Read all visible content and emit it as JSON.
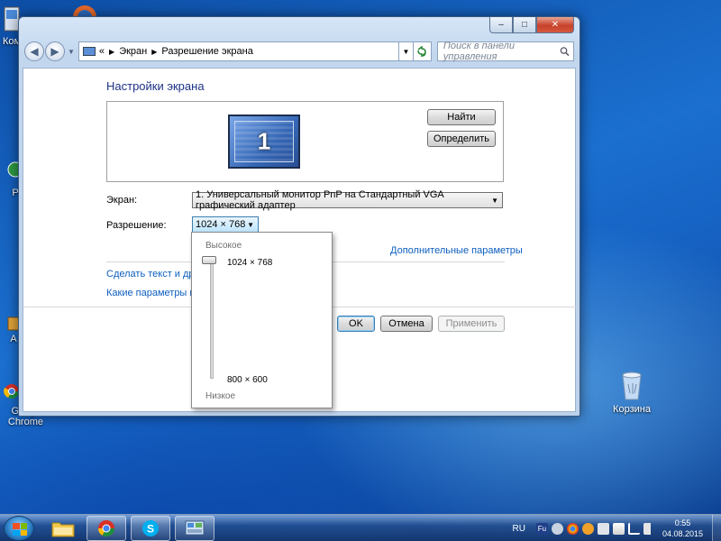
{
  "desktop": {
    "icons": [
      {
        "label": "Ком"
      },
      {
        "label": ""
      },
      {
        "label": "P"
      },
      {
        "label": "A"
      },
      {
        "label": "Google Chrome"
      }
    ],
    "recycle_bin_label": "Корзина"
  },
  "window": {
    "caption_buttons": {
      "minimize": "–",
      "maximize": "□",
      "close": "✕"
    },
    "nav": {
      "back": "◀",
      "forward": "▶"
    },
    "address": {
      "prefix": "«",
      "crumbs": [
        "Экран",
        "Разрешение экрана"
      ]
    },
    "search": {
      "placeholder": "Поиск в панели управления"
    },
    "heading": "Настройки экрана",
    "monitor_number": "1",
    "buttons": {
      "find": "Найти",
      "identify": "Определить",
      "ok": "OK",
      "cancel": "Отмена",
      "apply": "Применить"
    },
    "display_label": "Экран:",
    "display_value": "1. Универсальный монитор PnP на Стандартный VGA графический адаптер",
    "resolution_label": "Разрешение:",
    "resolution_value": "1024 × 768",
    "advanced_link": "Дополнительные параметры",
    "link_text_size": "Сделать текст и другие",
    "link_which_params": "Какие параметры мон"
  },
  "resolution_popup": {
    "high_label": "Высокое",
    "low_label": "Низкое",
    "top_resolution": "1024 × 768",
    "bottom_resolution": "800 × 600",
    "slider_level": 1.0
  },
  "taskbar": {
    "language": "RU",
    "time": "0:55",
    "date": "04.08.2015",
    "pinned": [
      "explorer",
      "chrome",
      "skype",
      "control-panel"
    ]
  }
}
